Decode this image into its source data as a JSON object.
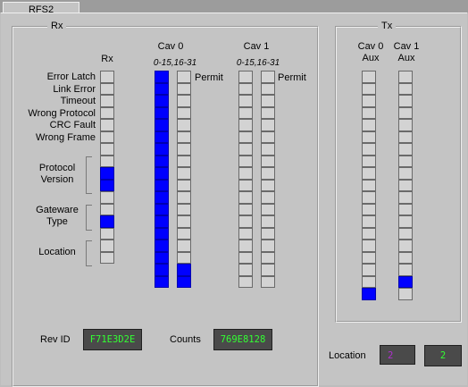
{
  "tab": {
    "label": "RFS2"
  },
  "rx": {
    "group_title": "Rx",
    "column_title": "Rx",
    "labels": [
      {
        "text": "Error Latch",
        "row": 0
      },
      {
        "text": "Link Error",
        "row": 1
      },
      {
        "text": "Timeout",
        "row": 2
      },
      {
        "text": "Wrong Protocol",
        "row": 3
      },
      {
        "text": "CRC Fault",
        "row": 4
      },
      {
        "text": "Wrong Frame",
        "row": 5
      }
    ],
    "bracket_groups": [
      {
        "label_line1": "Protocol",
        "label_line2": "Version",
        "row_start": 7,
        "row_end": 10
      },
      {
        "label_line1": "Gateware",
        "label_line2": "Type",
        "row_start": 11,
        "row_end": 13
      },
      {
        "label_line1": "Location",
        "label_line2": "",
        "row_start": 14,
        "row_end": 16
      }
    ]
  },
  "cav0": {
    "title": "Cav 0",
    "range": "0-15,16-31",
    "permit": "Permit"
  },
  "cav1": {
    "title": "Cav 1",
    "range": "0-15,16-31",
    "permit": "Permit"
  },
  "tx": {
    "group_title": "Tx",
    "cav0": {
      "title": "Cav 0",
      "sub": "Aux"
    },
    "cav1": {
      "title": "Cav 1",
      "sub": "Aux"
    }
  },
  "columns": {
    "rx": [
      0,
      0,
      0,
      0,
      0,
      0,
      0,
      0,
      1,
      1,
      0,
      0,
      1,
      0,
      0,
      0
    ],
    "cav0_a": [
      1,
      1,
      1,
      1,
      1,
      1,
      1,
      1,
      1,
      1,
      1,
      1,
      1,
      1,
      1,
      1,
      1,
      1
    ],
    "cav0_b": [
      0,
      0,
      0,
      0,
      0,
      0,
      0,
      0,
      0,
      0,
      0,
      0,
      0,
      0,
      0,
      0,
      1,
      1
    ],
    "cav1_a": [
      0,
      0,
      0,
      0,
      0,
      0,
      0,
      0,
      0,
      0,
      0,
      0,
      0,
      0,
      0,
      0,
      0,
      0
    ],
    "cav1_b": [
      0,
      0,
      0,
      0,
      0,
      0,
      0,
      0,
      0,
      0,
      0,
      0,
      0,
      0,
      0,
      0,
      0,
      0
    ],
    "tx_cav0": [
      0,
      0,
      0,
      0,
      0,
      0,
      0,
      0,
      0,
      0,
      0,
      0,
      0,
      0,
      0,
      0,
      0,
      0,
      1
    ],
    "tx_cav1": [
      0,
      0,
      0,
      0,
      0,
      0,
      0,
      0,
      0,
      0,
      0,
      0,
      0,
      0,
      0,
      0,
      0,
      1,
      0
    ]
  },
  "footer": {
    "rev_label": "Rev ID",
    "rev_value": "F71E3D2E",
    "counts_label": "Counts",
    "counts_value": "769E8128",
    "location_label": "Location",
    "location_input": "2",
    "location_value": "2"
  },
  "colors": {
    "on": "#0000ff",
    "off": "#d3d3d3",
    "value_text": "#33ff33",
    "value_bg": "#4a4a4a",
    "location_input_text": "#b030d0"
  }
}
